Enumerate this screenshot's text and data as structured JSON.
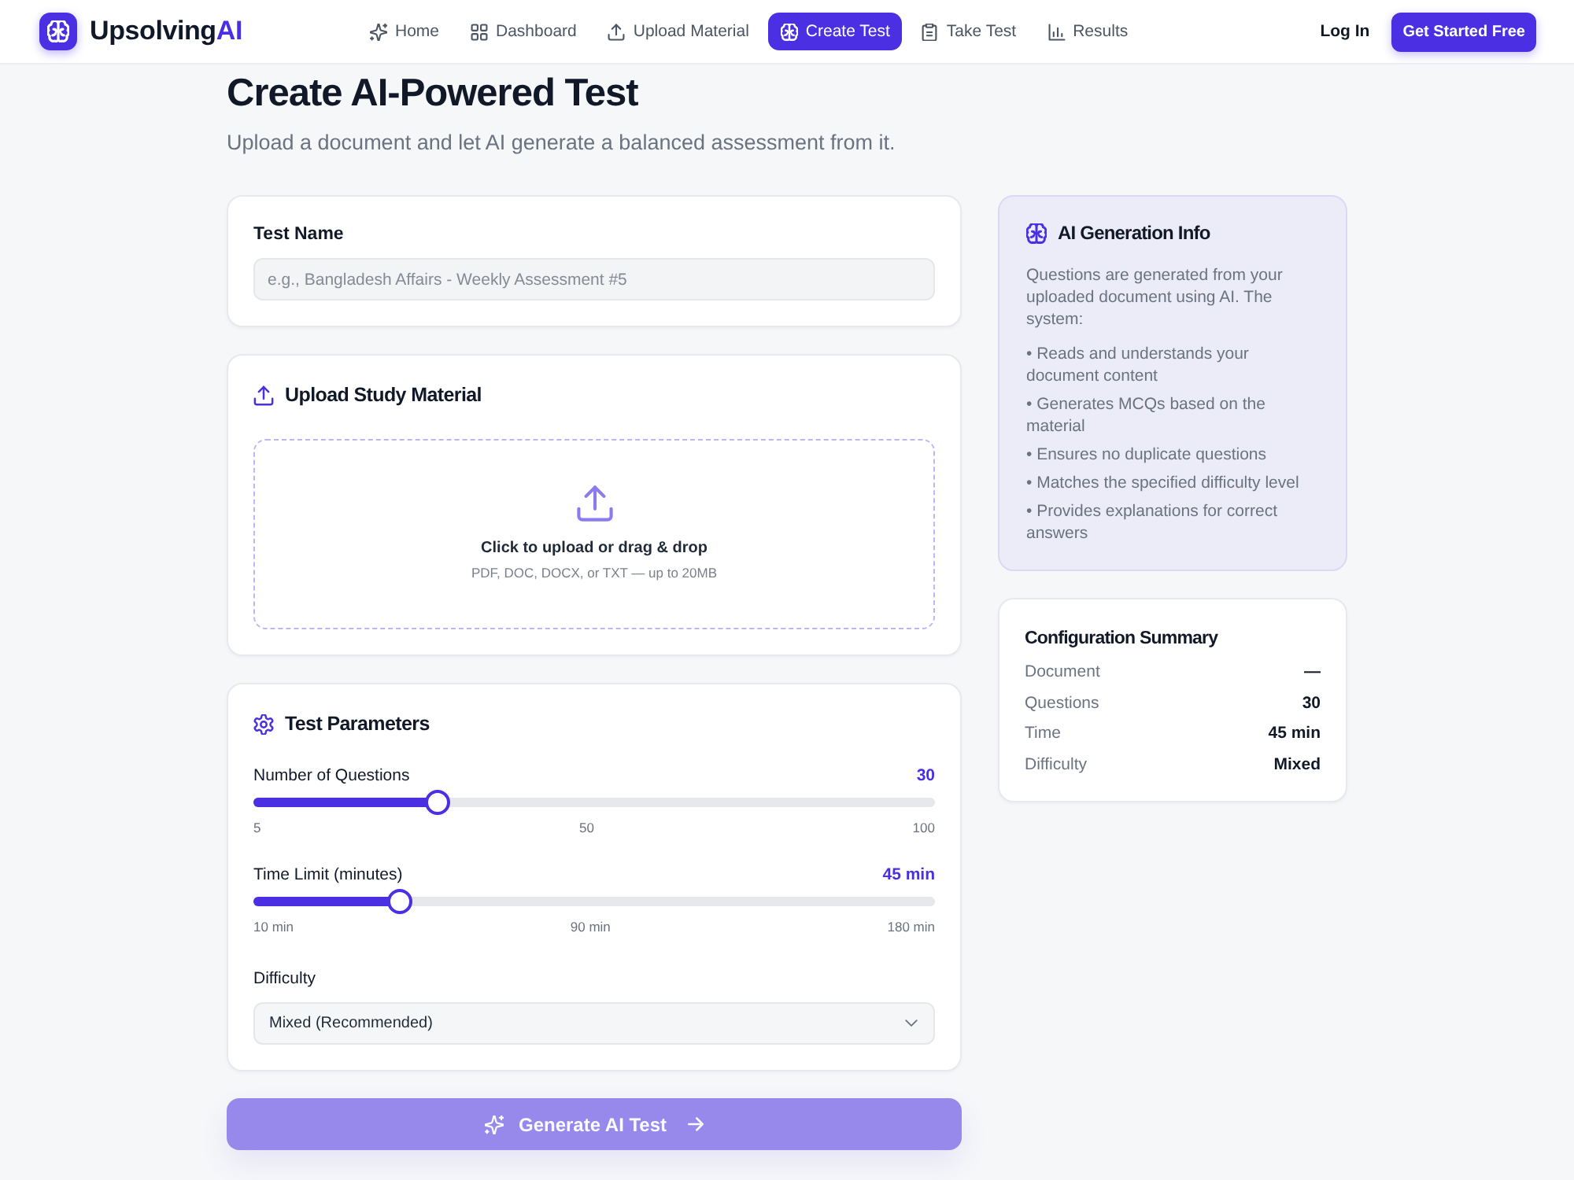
{
  "nav": {
    "brand": {
      "name": "Upsolving",
      "accent": "AI"
    },
    "items": [
      {
        "label": "Home",
        "selected": false
      },
      {
        "label": "Dashboard",
        "selected": false
      },
      {
        "label": "Upload Material",
        "selected": false
      },
      {
        "label": "Create Test",
        "selected": true
      },
      {
        "label": "Take Test",
        "selected": false
      },
      {
        "label": "Results",
        "selected": false
      }
    ],
    "login": "Log In",
    "cta": "Get Started Free"
  },
  "header": {
    "title": "Create AI-Powered Test",
    "subtitle": "Upload a document and let AI generate a balanced assessment from it."
  },
  "test_name": {
    "label": "Test Name",
    "placeholder": "e.g., Bangladesh Affairs - Weekly Assessment #5"
  },
  "upload": {
    "title": "Upload Study Material",
    "prompt": "Click to upload or drag & drop",
    "hint": "PDF, DOC, DOCX, or TXT — up to 20MB"
  },
  "parameters": {
    "title": "Test Parameters",
    "sliders": [
      {
        "label": "Number of Questions",
        "value": "30",
        "level": 0.27,
        "ticks": [
          "5",
          "50",
          "100"
        ]
      },
      {
        "label": "Time Limit (minutes)",
        "value": "45 min",
        "level": 0.215,
        "ticks": [
          "10 min",
          "90 min",
          "180 min"
        ]
      }
    ],
    "difficulty": {
      "label": "Difficulty",
      "value": "Mixed (Recommended)"
    }
  },
  "generate_button": {
    "label": "Generate AI Test",
    "disabled": true
  },
  "info": {
    "title": "AI Generation Info",
    "text": "Questions are generated from your uploaded document using AI. The system:",
    "bullets": [
      "• Reads and understands your document content",
      "• Generates MCQs based on the material",
      "• Ensures no duplicate questions",
      "• Matches the specified difficulty level",
      "• Provides explanations for correct answers"
    ]
  },
  "summary": {
    "title": "Configuration Summary",
    "rows": [
      {
        "label": "Document",
        "value": "—"
      },
      {
        "label": "Questions",
        "value": "30"
      },
      {
        "label": "Time",
        "value": "45 min"
      },
      {
        "label": "Difficulty",
        "value": "Mixed"
      }
    ]
  }
}
